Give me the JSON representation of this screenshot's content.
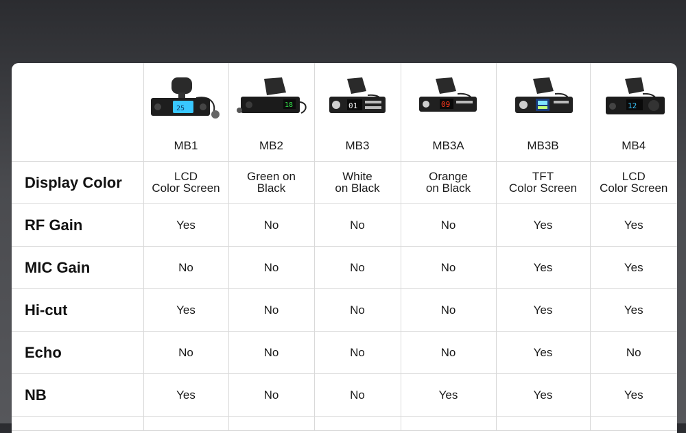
{
  "models": [
    "MB1",
    "MB2",
    "MB3",
    "MB3A",
    "MB3B",
    "MB4"
  ],
  "radio_icons": [
    "cb-radio-mb1-icon",
    "cb-radio-mb2-icon",
    "cb-radio-mb3-icon",
    "cb-radio-mb3a-icon",
    "cb-radio-mb3b-icon",
    "cb-radio-mb4-icon"
  ],
  "display_colors": {
    "label": "Display Color",
    "values": [
      [
        "LCD",
        "Color Screen"
      ],
      [
        "Green on",
        "Black"
      ],
      [
        "White",
        "on Black"
      ],
      [
        "Orange",
        "on Black"
      ],
      [
        "TFT",
        "Color Screen"
      ],
      [
        "LCD",
        "Color Screen"
      ]
    ]
  },
  "features": [
    {
      "label": "RF Gain",
      "values": [
        "Yes",
        "No",
        "No",
        "No",
        "Yes",
        "Yes"
      ]
    },
    {
      "label": "MIC Gain",
      "values": [
        "No",
        "No",
        "No",
        "No",
        "Yes",
        "Yes"
      ]
    },
    {
      "label": "Hi-cut",
      "values": [
        "Yes",
        "No",
        "No",
        "No",
        "Yes",
        "Yes"
      ]
    },
    {
      "label": "Echo",
      "values": [
        "No",
        "No",
        "No",
        "No",
        "Yes",
        "No"
      ]
    },
    {
      "label": "NB",
      "values": [
        "Yes",
        "No",
        "No",
        "Yes",
        "Yes",
        "Yes"
      ]
    }
  ],
  "colors": {
    "background_top": "#2b2c30",
    "background_bottom": "#56575b",
    "card": "#ffffff",
    "grid": "#d9d9d9",
    "lcd_blue": "#39c8ff",
    "lcd_green": "#35e04a",
    "lcd_orange": "#ff3a1e"
  }
}
